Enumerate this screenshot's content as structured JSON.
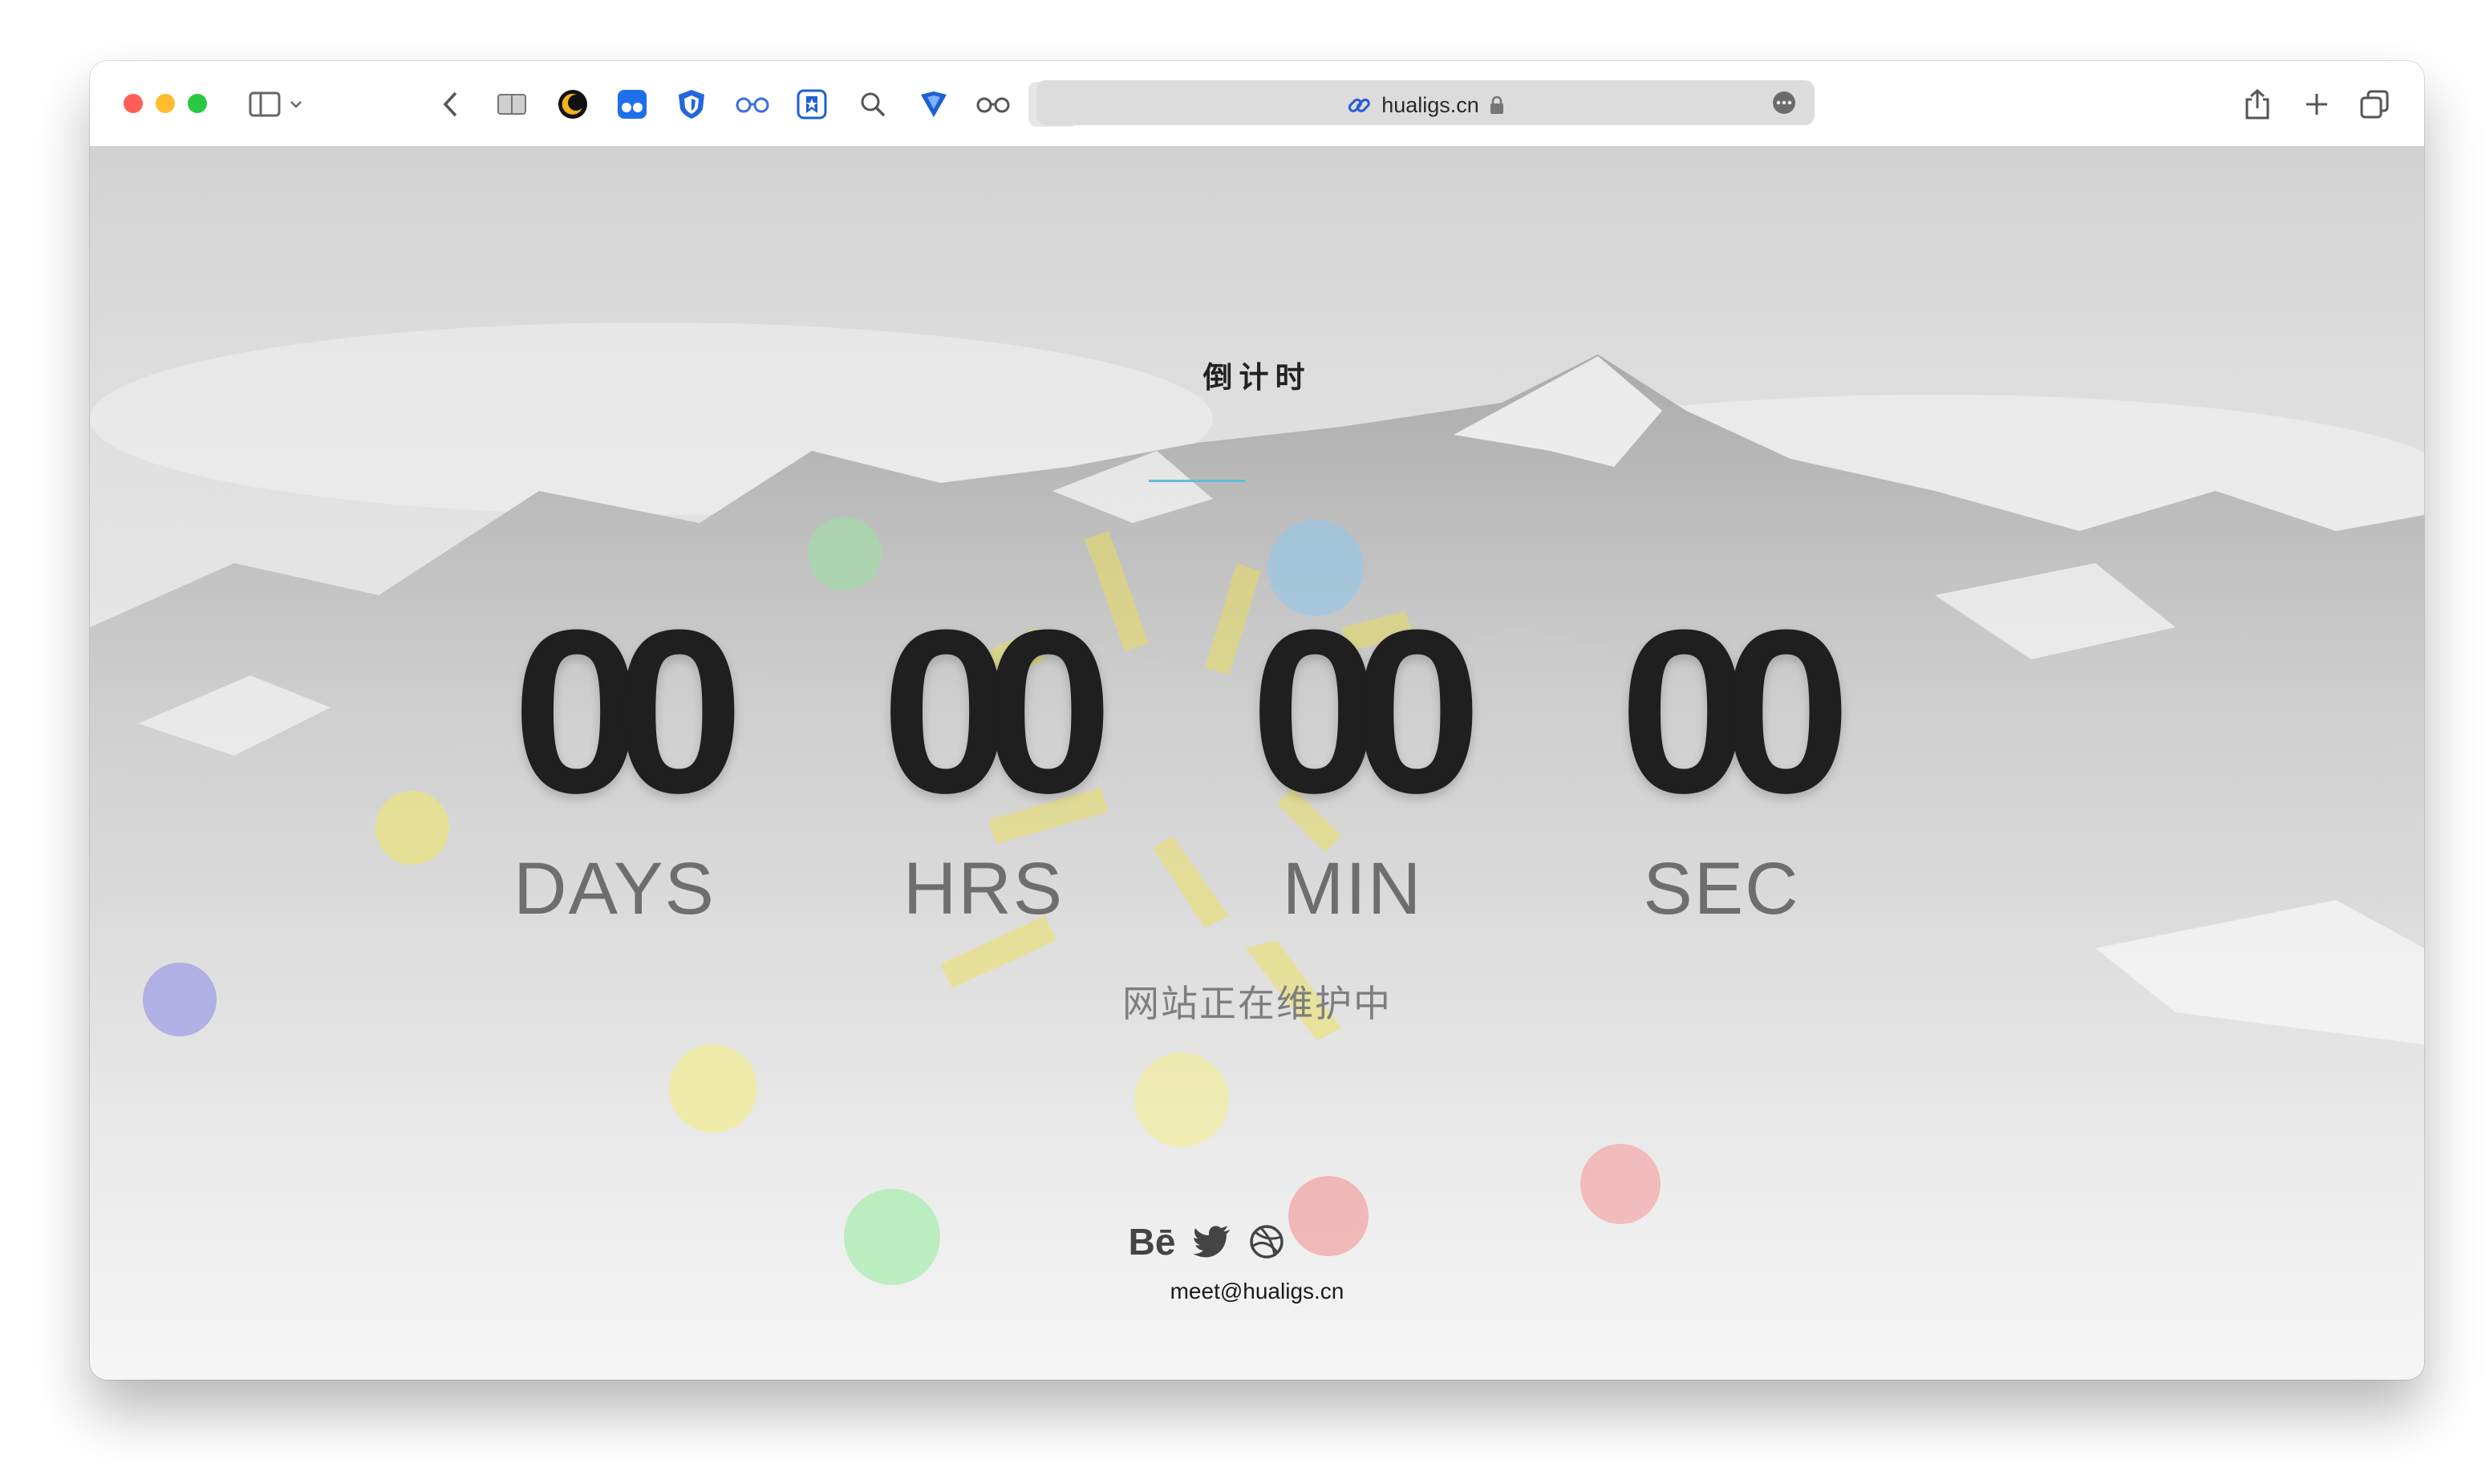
{
  "browser": {
    "url": "hualigs.cn",
    "toolbar_icons": [
      "sidebar-icon",
      "chevron-down-icon",
      "back-icon",
      "reader-icon",
      "dark-reader-icon",
      "extension-icon",
      "shield-icon",
      "glasses-icon",
      "bookmark-icon",
      "search-icon",
      "vpn-icon",
      "glasses-icon",
      "vpn-icon",
      "share-icon",
      "plus-icon",
      "tabs-icon"
    ],
    "colors": {
      "close": "#ff5f57",
      "minimize": "#febc2e",
      "zoom": "#28c840"
    }
  },
  "page": {
    "heading": "倒计时",
    "countdown": [
      {
        "value": "00",
        "label": "DAYS"
      },
      {
        "value": "00",
        "label": "HRS"
      },
      {
        "value": "00",
        "label": "MIN"
      },
      {
        "value": "00",
        "label": "SEC"
      }
    ],
    "maintenance_text": "网站正在维护中",
    "social_icons": [
      "behance-icon",
      "twitter-icon",
      "dribbble-icon"
    ],
    "behance_label": "Bē",
    "email": "meet@hualigs.cn",
    "accent_color": "#5bc0d8"
  }
}
